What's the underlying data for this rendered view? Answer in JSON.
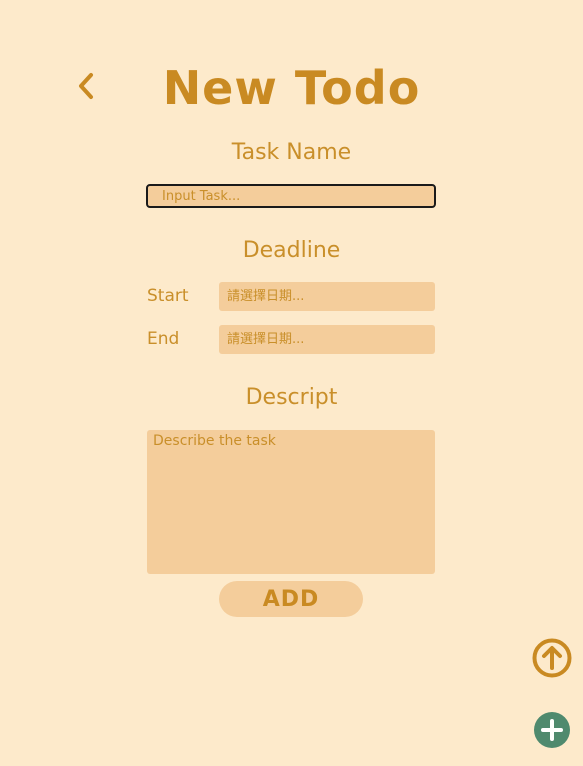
{
  "header": {
    "title": "New Todo"
  },
  "task": {
    "label": "Task Name",
    "placeholder": "Input Task..."
  },
  "deadline": {
    "label": "Deadline",
    "start_label": "Start",
    "start_placeholder": "請選擇日期...",
    "end_label": "End",
    "end_placeholder": "請選擇日期..."
  },
  "descript": {
    "label": "Descript",
    "placeholder": "Describe the task"
  },
  "actions": {
    "add_label": "ADD"
  },
  "icons": {
    "back": "chevron-left-icon",
    "scroll_up": "arrow-up-circle-icon",
    "add_todo": "plus-circle-icon"
  },
  "colors": {
    "background": "#fdeacb",
    "accent": "#c98a22",
    "field": "#f4cd9b",
    "plus_button": "#4f8a6e"
  }
}
